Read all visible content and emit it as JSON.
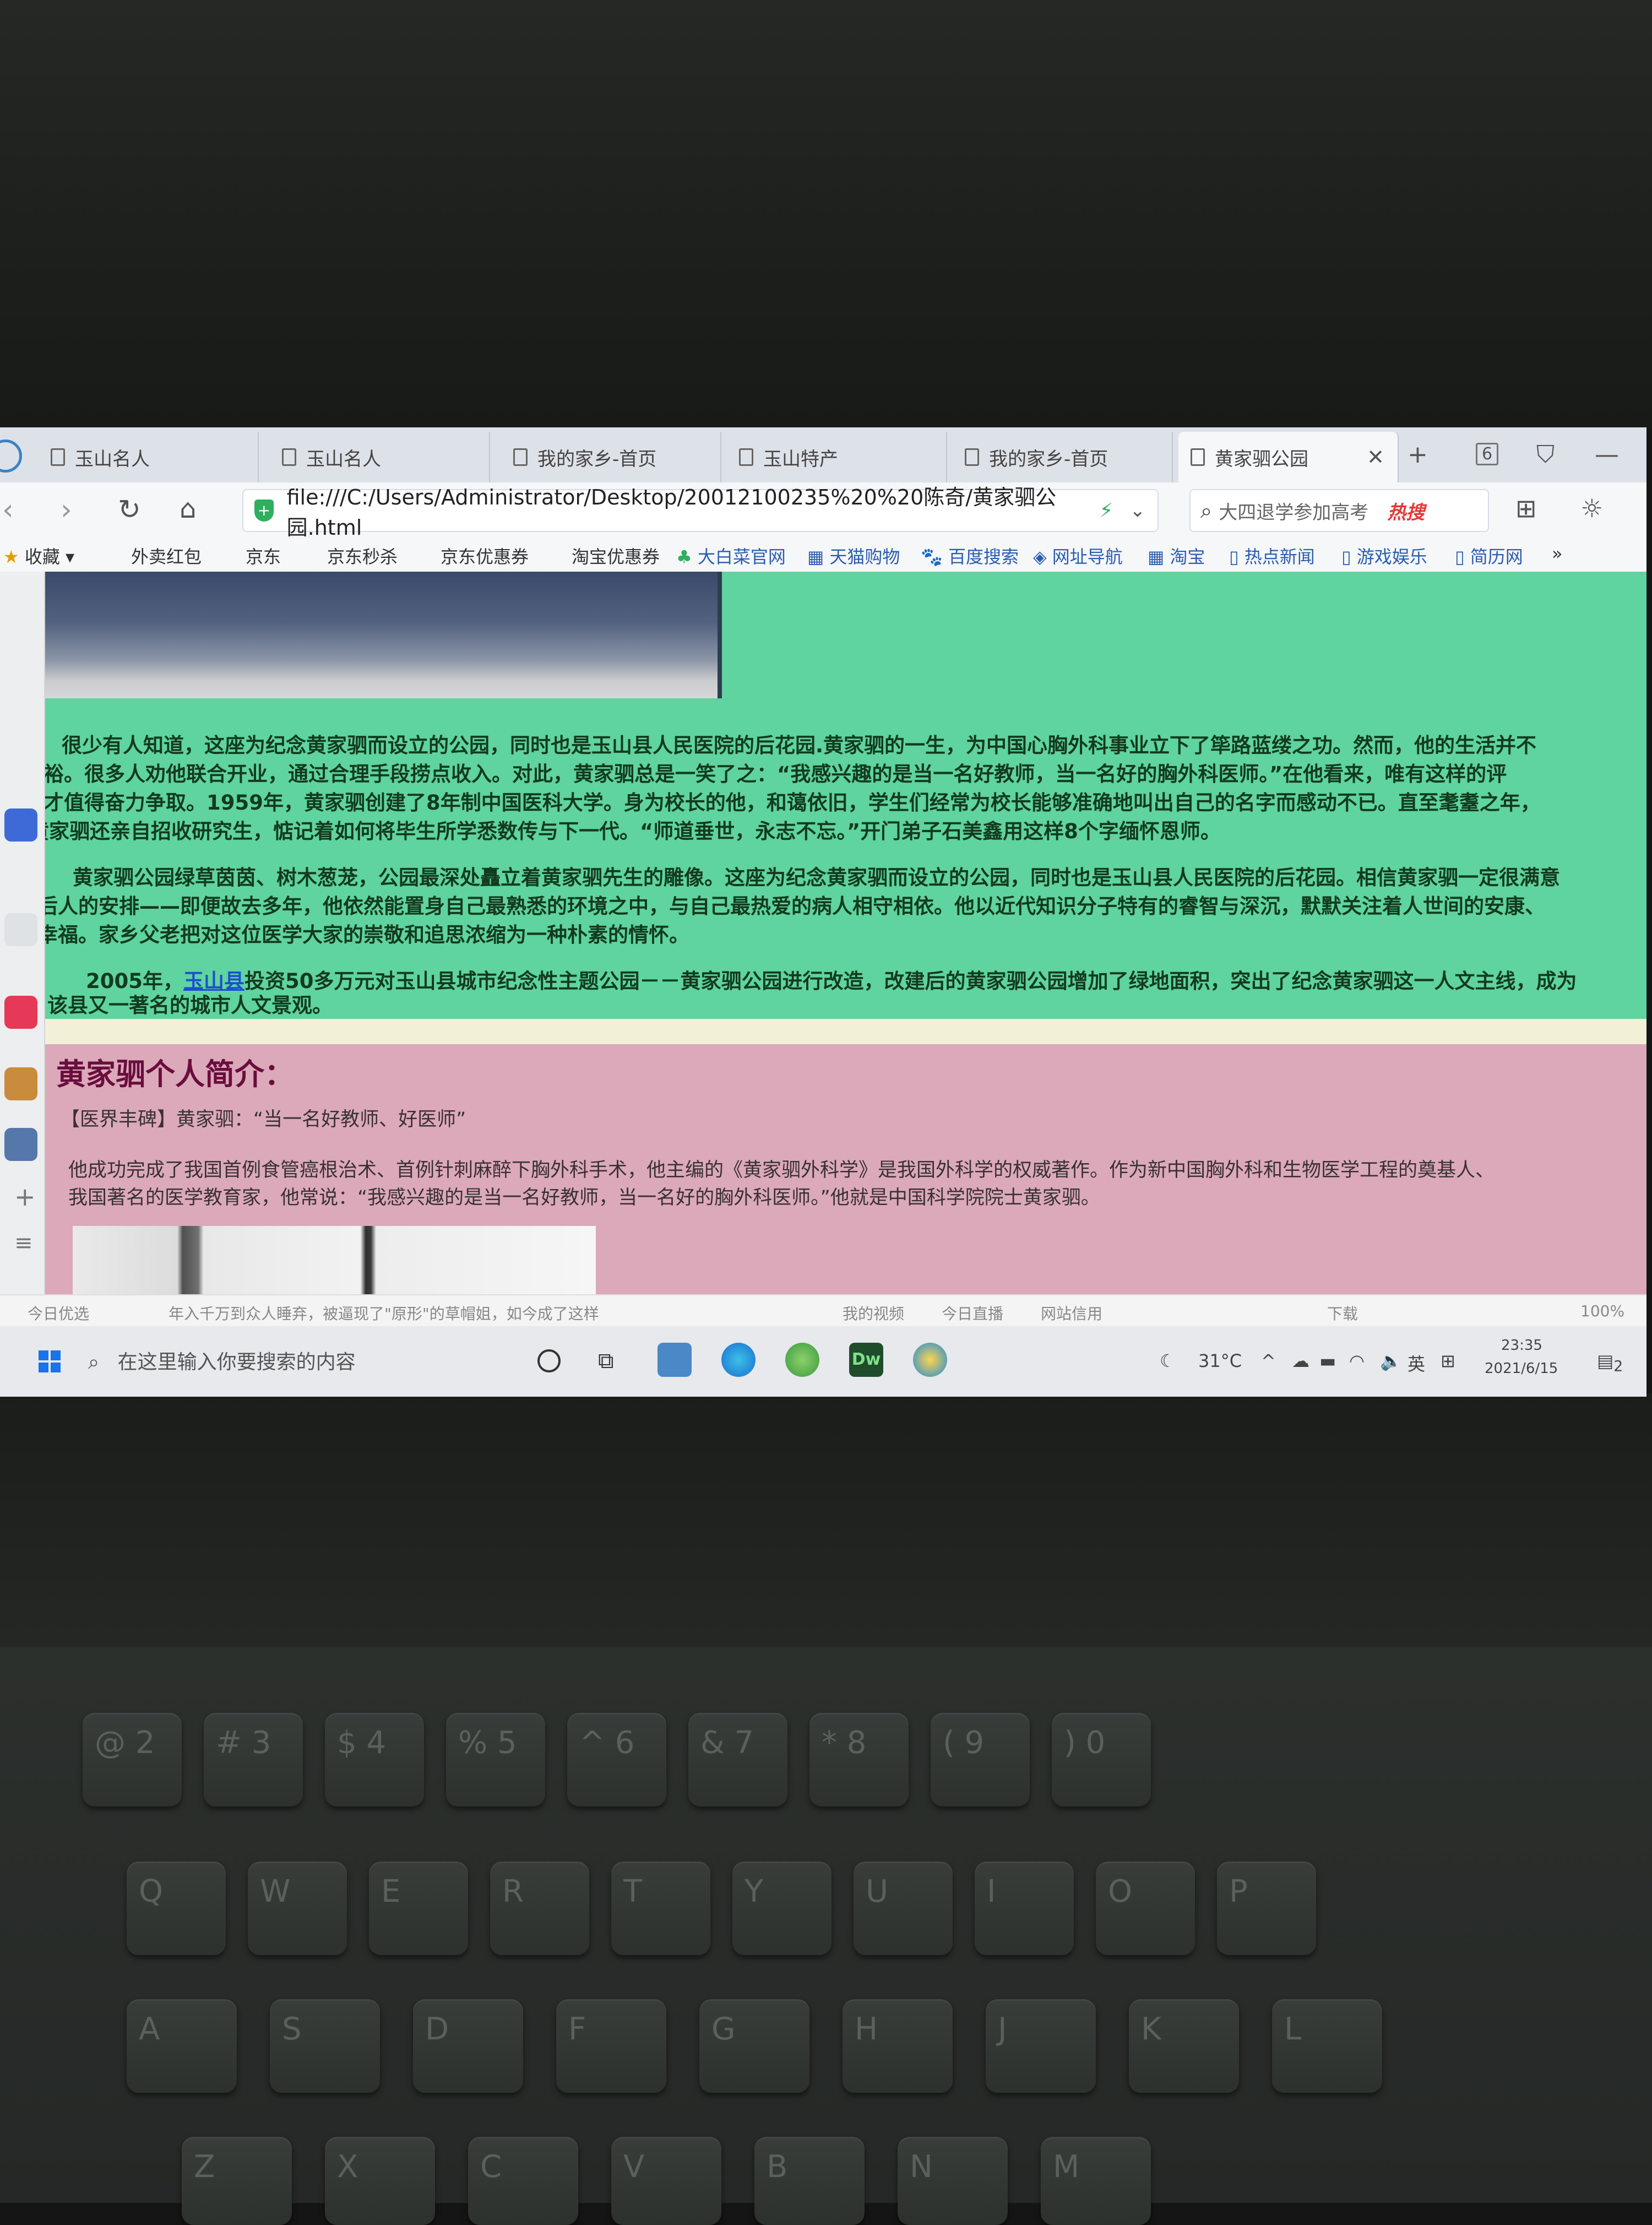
{
  "browser": {
    "tabs": [
      {
        "label": "玉山名人"
      },
      {
        "label": "玉山名人"
      },
      {
        "label": "我的家乡-首页"
      },
      {
        "label": "玉山特产"
      },
      {
        "label": "我的家乡-首页"
      },
      {
        "label": "黄家驷公园",
        "active": true
      }
    ],
    "tab_count": "6",
    "url": "file:///C:/Users/Administrator/Desktop/20012100235%20%20陈奇/黄家驷公园.html",
    "search_placeholder": "大四退学参加高考",
    "search_hot": "热搜",
    "bookmarks": [
      "收藏",
      "外卖红包",
      "京东",
      "京东秒杀",
      "京东优惠券",
      "淘宝优惠券",
      "大白菜官网",
      "天猫购物",
      "百度搜索",
      "网址导航",
      "淘宝",
      "热点新闻",
      "游戏娱乐",
      "简历网",
      "»"
    ]
  },
  "page": {
    "para1": [
      "很少有人知道，这座为纪念黄家驷而设立的公园，同时也是玉山县人民医院的后花园.黄家驷的一生，为中国心胸外科事业立下了筚路蓝缕之功。然而，他的生活并不",
      "宽裕。很多人劝他联合开业，通过合理手段捞点收入。对此，黄家驷总是一笑了之：“我感兴趣的是当一名好教师，当一名好的胸外科医师。”在他看来，唯有这样的评",
      "价才值得奋力争取。1959年，黄家驷创建了8年制中国医科大学。身为校长的他，和蔼依旧，学生们经常为校长能够准确地叫出自己的名字而感动不已。直至耄耋之年，",
      "黄家驷还亲自招收研究生，惦记着如何将毕生所学悉数传与下一代。“师道垂世，永志不忘。”开门弟子石美鑫用这样8个字缅怀恩师。"
    ],
    "para2": [
      "黄家驷公园绿草茵茵、树木葱茏，公园最深处矗立着黄家驷先生的雕像。这座为纪念黄家驷而设立的公园，同时也是玉山县人民医院的后花园。相信黄家驷一定很满意",
      "后人的安排——即便故去多年，他依然能置身自己最熟悉的环境之中，与自己最热爱的病人相守相依。他以近代知识分子特有的睿智与深沉，默默关注着人世间的安康、",
      "幸福。家乡父老把对这位医学大家的崇敬和追思浓缩为一种朴素的情怀。"
    ],
    "para3_prefix": "2005年，",
    "para3_link": "玉山县",
    "para3_line1": "投资50多万元对玉山县城市纪念性主题公园－－黄家驷公园进行改造，改建后的黄家驷公园增加了绿地面积，突出了纪念黄家驷这一人文主线，成为",
    "para3_line2": "该县又一著名的城市人文景观。",
    "profile_title": "黄家驷个人简介：",
    "profile_quote": "【医界丰碑】黄家驷：“当一名好教师、好医师”",
    "profile_body": [
      "他成功完成了我国首例食管癌根治术、首例针刺麻醉下胸外科手术，他主编的《黄家驷外科学》是我国外科学的权威著作。作为新中国胸外科和生物医学工程的奠基人、",
      "我国著名的医学教育家，他常说：“我感兴趣的是当一名好教师，当一名好的胸外科医师。”他就是中国科学院院士黄家驷。"
    ]
  },
  "statusbar": {
    "today": "今日优选",
    "news": "年入千万到众人睡弃，被逼现了\"原形\"的草帽姐，如今成了这样",
    "video": "我的视频",
    "live": "今日直播",
    "credit": "网站信用",
    "download": "下载",
    "zoom": "100%"
  },
  "taskbar": {
    "search": "在这里输入你要搜索的内容",
    "temp": "31°C",
    "ime": "英",
    "time": "23:35",
    "date": "2021/6/15",
    "notif": "2"
  },
  "keyboard": {
    "row1": [
      "@",
      "#",
      "$",
      "%",
      "^",
      "&",
      "*",
      "(",
      ")"
    ],
    "row1b": [
      "2",
      "3",
      "4",
      "5",
      "6",
      "7",
      "8",
      "9",
      "0"
    ],
    "row2": [
      "Q",
      "W",
      "E",
      "R",
      "T",
      "Y",
      "U",
      "I",
      "O",
      "P"
    ],
    "row3": [
      "A",
      "S",
      "D",
      "F",
      "G",
      "H",
      "J",
      "K",
      "L"
    ],
    "row4": [
      "Z",
      "X",
      "C",
      "V",
      "B",
      "N",
      "M"
    ]
  },
  "colors": {
    "green_section": "#5fd3a0",
    "pink_section": "#dba9b9",
    "title": "#6a0d3d"
  }
}
